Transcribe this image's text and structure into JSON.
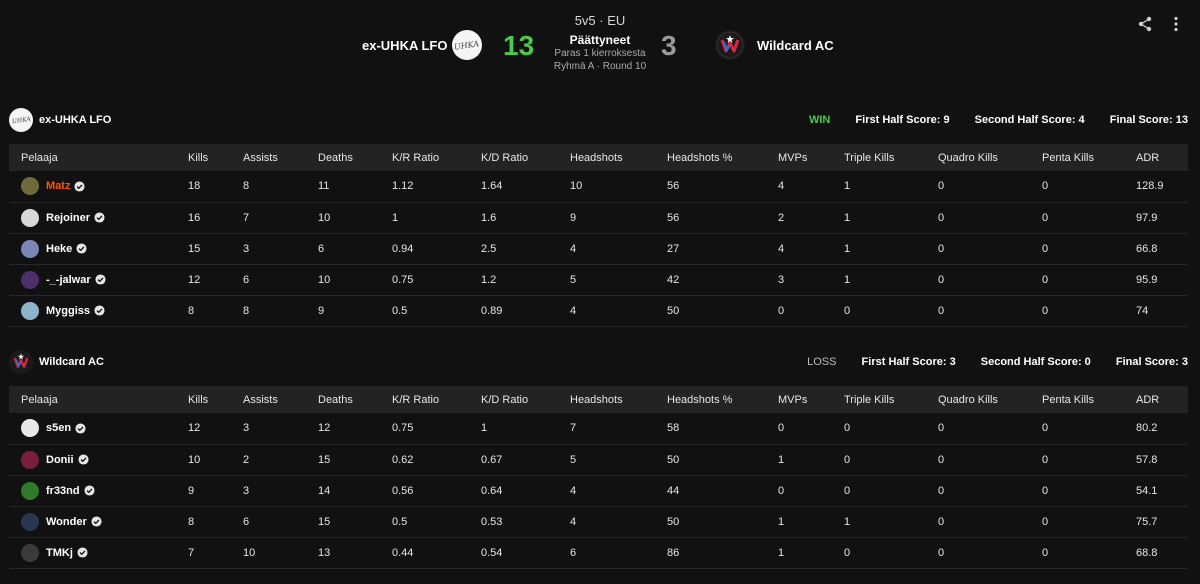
{
  "match": {
    "mode": "5v5 · EU",
    "status": "Päättyneet",
    "format": "Paras 1 kierroksesta",
    "round_info": "Ryhmä A · Round 10",
    "team1": {
      "name": "ex-UHKA LFO",
      "score": "13",
      "score_color": "#4cc84a"
    },
    "team2": {
      "name": "Wildcard AC",
      "score": "3",
      "score_color": "#9a9a9a"
    }
  },
  "icons": {
    "share": "share-icon",
    "menu": "more-vertical-icon",
    "verified": "verified-badge-icon"
  },
  "columns": [
    "Pelaaja",
    "Kills",
    "Assists",
    "Deaths",
    "K/R Ratio",
    "K/D Ratio",
    "Headshots",
    "Headshots %",
    "MVPs",
    "Triple Kills",
    "Quadro Kills",
    "Penta Kills",
    "ADR"
  ],
  "teams": [
    {
      "name": "ex-UHKA LFO",
      "result": "WIN",
      "first_half": "First Half Score: 9",
      "second_half": "Second Half Score: 4",
      "final": "Final Score: 13",
      "players": [
        {
          "name": "Matz",
          "highlight": true,
          "avatar_color": "#6e6a3a",
          "stats": [
            "18",
            "8",
            "11",
            "1.12",
            "1.64",
            "10",
            "56",
            "4",
            "1",
            "0",
            "0",
            "128.9"
          ]
        },
        {
          "name": "Rejoiner",
          "highlight": false,
          "avatar_color": "#d9d9d9",
          "stats": [
            "16",
            "7",
            "10",
            "1",
            "1.6",
            "9",
            "56",
            "2",
            "1",
            "0",
            "0",
            "97.9"
          ]
        },
        {
          "name": "Heke",
          "highlight": false,
          "avatar_color": "#7a86b8",
          "stats": [
            "15",
            "3",
            "6",
            "0.94",
            "2.5",
            "4",
            "27",
            "4",
            "1",
            "0",
            "0",
            "66.8"
          ]
        },
        {
          "name": "-_-jalwar",
          "highlight": false,
          "avatar_color": "#4a2f6b",
          "stats": [
            "12",
            "6",
            "10",
            "0.75",
            "1.2",
            "5",
            "42",
            "3",
            "1",
            "0",
            "0",
            "95.9"
          ]
        },
        {
          "name": "Myggiss",
          "highlight": false,
          "avatar_color": "#8fb3c9",
          "stats": [
            "8",
            "8",
            "9",
            "0.5",
            "0.89",
            "4",
            "50",
            "0",
            "0",
            "0",
            "0",
            "74"
          ]
        }
      ]
    },
    {
      "name": "Wildcard AC",
      "result": "LOSS",
      "first_half": "First Half Score: 3",
      "second_half": "Second Half Score: 0",
      "final": "Final Score: 3",
      "players": [
        {
          "name": "s5en",
          "highlight": false,
          "avatar_color": "#e8e8e8",
          "stats": [
            "12",
            "3",
            "12",
            "0.75",
            "1",
            "7",
            "58",
            "0",
            "0",
            "0",
            "0",
            "80.2"
          ]
        },
        {
          "name": "Donii",
          "highlight": false,
          "avatar_color": "#7a1f3a",
          "stats": [
            "10",
            "2",
            "15",
            "0.62",
            "0.67",
            "5",
            "50",
            "1",
            "0",
            "0",
            "0",
            "57.8"
          ]
        },
        {
          "name": "fr33nd",
          "highlight": false,
          "avatar_color": "#2e7a2a",
          "stats": [
            "9",
            "3",
            "14",
            "0.56",
            "0.64",
            "4",
            "44",
            "0",
            "0",
            "0",
            "0",
            "54.1"
          ]
        },
        {
          "name": "Wonder",
          "highlight": false,
          "avatar_color": "#2a3550",
          "stats": [
            "8",
            "6",
            "15",
            "0.5",
            "0.53",
            "4",
            "50",
            "1",
            "1",
            "0",
            "0",
            "75.7"
          ]
        },
        {
          "name": "TMKj",
          "highlight": false,
          "avatar_color": "#3a3a3a",
          "stats": [
            "7",
            "10",
            "13",
            "0.44",
            "0.54",
            "6",
            "86",
            "1",
            "0",
            "0",
            "0",
            "68.8"
          ]
        }
      ]
    }
  ]
}
